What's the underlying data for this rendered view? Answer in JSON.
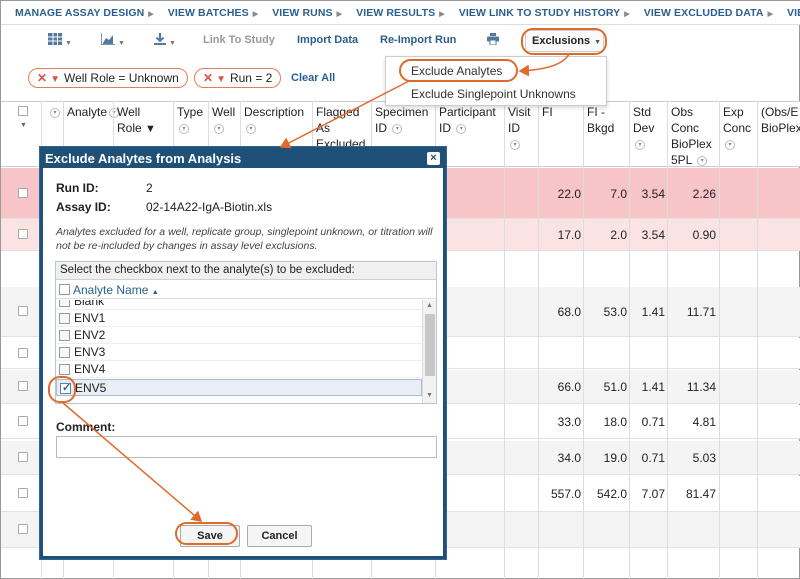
{
  "topnav": {
    "items": [
      "MANAGE ASSAY DESIGN",
      "VIEW BATCHES",
      "VIEW RUNS",
      "VIEW RESULTS",
      "VIEW LINK TO STUDY HISTORY",
      "VIEW EXCLUDED DATA",
      "VIEW QC RE"
    ]
  },
  "toolbar": {
    "grid_icon": "grid-icon",
    "chart_icon": "chart-icon",
    "export_icon": "download-icon",
    "link_to_study": "Link To Study",
    "import_data": "Import Data",
    "reimport_run": "Re-Import Run",
    "print_icon": "print-icon",
    "exclusions": "Exclusions"
  },
  "filters": {
    "chips": [
      "Well Role = Unknown",
      "Run = 2"
    ],
    "clear_all": "Clear All"
  },
  "exclusions_menu": {
    "items": [
      "Exclude Analytes",
      "Exclude Singlepoint Unknowns"
    ]
  },
  "grid": {
    "headers": {
      "analyte": "Analyte",
      "well_role": [
        "Well",
        "Role"
      ],
      "type": "Type",
      "well": "Well",
      "description": "Description",
      "flagged": [
        "Flagged",
        "As",
        "Excluded"
      ],
      "specimen": [
        "Specimen",
        "ID"
      ],
      "participant": [
        "Participant",
        "ID"
      ],
      "visit": [
        "Visit",
        "ID"
      ],
      "fi": "FI",
      "fi_bkgd": [
        "FI -",
        "Bkgd"
      ],
      "std_dev": [
        "Std",
        "Dev"
      ],
      "obs_conc": [
        "Obs",
        "Conc",
        "BioPlex",
        "5PL"
      ],
      "exp_conc": [
        "Exp",
        "Conc"
      ],
      "obs_exp": [
        "(Obs/E",
        "BioPlex"
      ]
    },
    "rows": [
      {
        "fi": "22.0",
        "fi_bkgd": "7.0",
        "std_dev": "3.54",
        "obs_conc": "2.26",
        "highlight": "#f7c4c8"
      },
      {
        "fi": "17.0",
        "fi_bkgd": "2.0",
        "std_dev": "3.54",
        "obs_conc": "0.90",
        "highlight": "#fbe3e4"
      },
      {
        "fi": "68.0",
        "fi_bkgd": "53.0",
        "std_dev": "1.41",
        "obs_conc": "11.71",
        "highlight": "#f4f4f4"
      },
      {
        "fi": "",
        "fi_bkgd": "",
        "std_dev": "",
        "obs_conc": "",
        "highlight": "#ffffff"
      },
      {
        "fi": "66.0",
        "fi_bkgd": "51.0",
        "std_dev": "1.41",
        "obs_conc": "11.34",
        "highlight": "#f4f4f4"
      },
      {
        "fi": "33.0",
        "fi_bkgd": "18.0",
        "std_dev": "0.71",
        "obs_conc": "4.81",
        "highlight": "#ffffff"
      },
      {
        "fi": "34.0",
        "fi_bkgd": "19.0",
        "std_dev": "0.71",
        "obs_conc": "5.03",
        "highlight": "#f4f4f4"
      },
      {
        "fi": "557.0",
        "fi_bkgd": "542.0",
        "std_dev": "7.07",
        "obs_conc": "81.47",
        "highlight": "#ffffff"
      },
      {
        "fi": "",
        "fi_bkgd": "",
        "std_dev": "",
        "obs_conc": "",
        "highlight": "#f4f4f4"
      }
    ]
  },
  "dialog": {
    "title": "Exclude Analytes from Analysis",
    "close": "×",
    "run_id_label": "Run ID:",
    "run_id": "2",
    "assay_id_label": "Assay ID:",
    "assay_id": "02-14A22-IgA-Biotin.xls",
    "note": "Analytes excluded for a well, replicate group, singlepoint unknown, or titration will not be re-included by changes in assay level exclusions.",
    "panel_header": "Select the checkbox next to the analyte(s) to be excluded:",
    "column_name": "Analyte Name",
    "analytes": [
      {
        "name": "Blank",
        "checked": false
      },
      {
        "name": "ENV1",
        "checked": false
      },
      {
        "name": "ENV2",
        "checked": false
      },
      {
        "name": "ENV3",
        "checked": false
      },
      {
        "name": "ENV4",
        "checked": false
      },
      {
        "name": "ENV5",
        "checked": true
      }
    ],
    "comment_label": "Comment:",
    "comment_value": "",
    "save": "Save",
    "cancel": "Cancel"
  },
  "colors": {
    "link": "#2b5f8f",
    "dialog_header": "#1e5078",
    "annotation": "#e06a2c",
    "row_excluded": "#f7c4c8"
  }
}
